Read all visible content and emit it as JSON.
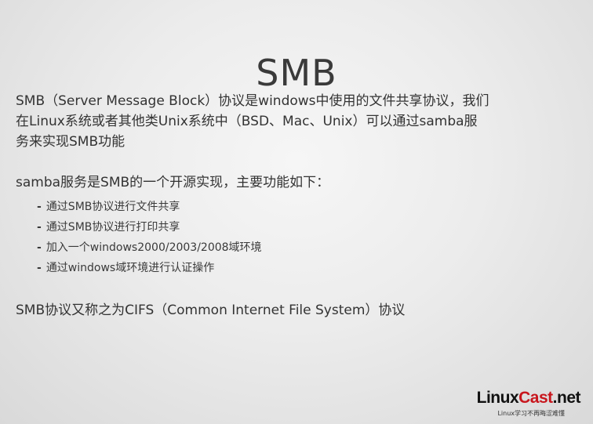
{
  "slide": {
    "title": "SMB",
    "intro_lines": [
      "SMB（Server Message Block）协议是windows中使用的文件共享协议，我们",
      "在Linux系统或者其他类Unix系统中（BSD、Mac、Unix）可以通过samba服",
      "务来实现SMB功能"
    ],
    "samba_heading": "samba服务是SMB的一个开源实现，主要功能如下：",
    "bullet_marker": "-",
    "bullets": [
      "通过SMB协议进行文件共享",
      "通过SMB协议进行打印共享",
      "加入一个windows2000/2003/2008域环境",
      "通过windows域环境进行认证操作"
    ],
    "cifs_note": "SMB协议又称之为CIFS（Common Internet File System）协议"
  },
  "logo": {
    "name_part1": "Linux",
    "name_part2": "Cast",
    "name_part3": ".net",
    "tagline": "Linux学习不再晦涩难懂"
  },
  "colors": {
    "logo_accent": "#c8161d",
    "text": "#333333"
  }
}
